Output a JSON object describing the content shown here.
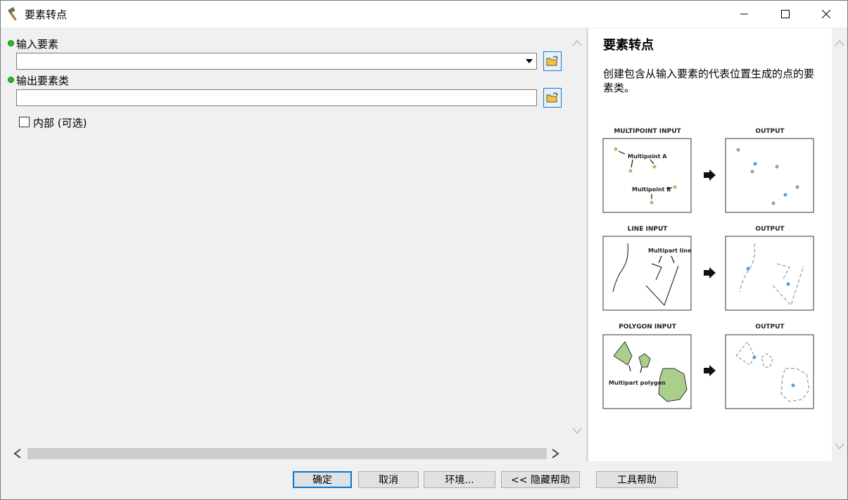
{
  "window": {
    "title": "要素转点"
  },
  "form": {
    "input_features_label": "输入要素",
    "input_features_value": "",
    "output_class_label": "输出要素类",
    "output_class_value": "",
    "inside_label": "内部 (可选)"
  },
  "help": {
    "title": "要素转点",
    "description": "创建包含从输入要素的代表位置生成的点的要素类。",
    "diagram": {
      "multipoint_input": "MULTIPOINT INPUT",
      "line_input": "LINE INPUT",
      "polygon_input": "POLYGON INPUT",
      "output": "OUTPUT",
      "multipoint_a": "Multipoint A",
      "multipoint_b": "Multipoint B",
      "multipart_line": "Multipart line",
      "multipart_polygon": "Multipart polygon"
    }
  },
  "buttons": {
    "ok": "确定",
    "cancel": "取消",
    "environments": "环境...",
    "hide_help": "<< 隐藏帮助",
    "tool_help": "工具帮助"
  },
  "colors": {
    "required_dot": "#1fc01f",
    "accent": "#0078d7",
    "polygon_fill": "#a9cf8a",
    "output_point": "#5b9bd5",
    "input_point": "#8dc86b"
  }
}
